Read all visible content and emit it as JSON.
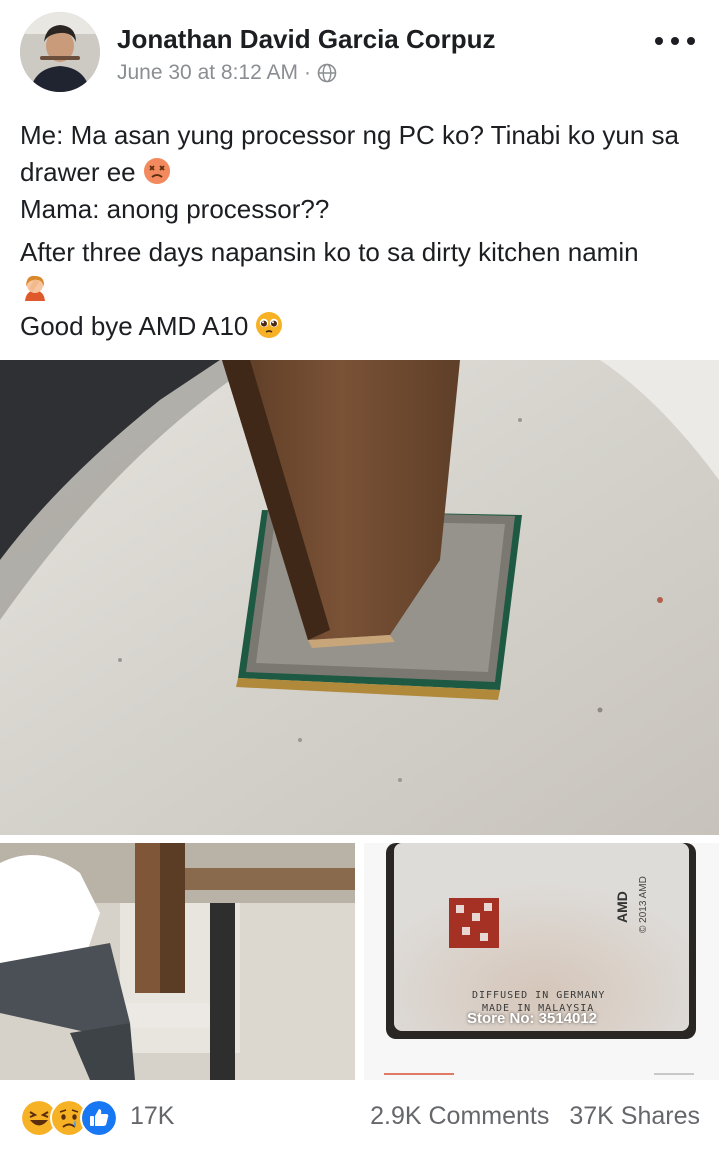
{
  "post": {
    "author": "Jonathan David Garcia Corpuz",
    "timestamp": "June 30 at 8:12 AM",
    "separator": "·",
    "privacy_icon": "globe-icon",
    "menu_icon": "more-options-icon",
    "lines": {
      "l1": "Me: Ma asan yung processor ng PC ko? Tinabi ko yun sa drawer ee",
      "l2": "Mama: anong processor??",
      "l3": "After three days napansin ko to sa dirty kitchen namin",
      "l4": "Good bye AMD A10"
    },
    "emojis": [
      "dizzy-face-icon",
      "facepalm-woman-icon",
      "pleading-face-icon"
    ]
  },
  "photos": {
    "main": "cpu-under-table-leg-photo",
    "left": "table-leg-on-stool-photo",
    "right": "amd-chip-closeup-photo",
    "right_chip_text": {
      "line1": "DIFFUSED IN GERMANY",
      "line2": "MADE IN MALAYSIA",
      "brand": "AMD",
      "year": "© 2013 AMD"
    },
    "store_label": "Store No: 3514012"
  },
  "footer": {
    "reaction_icons": [
      "haha-reaction-icon",
      "sad-reaction-icon",
      "like-reaction-icon"
    ],
    "reaction_count": "17K",
    "comments": "2.9K Comments",
    "shares": "37K Shares"
  },
  "colors": {
    "text": "#1c1e21",
    "secondary": "#65676b",
    "like_blue": "#1877f2",
    "reaction_yellow": "#f7b125"
  }
}
